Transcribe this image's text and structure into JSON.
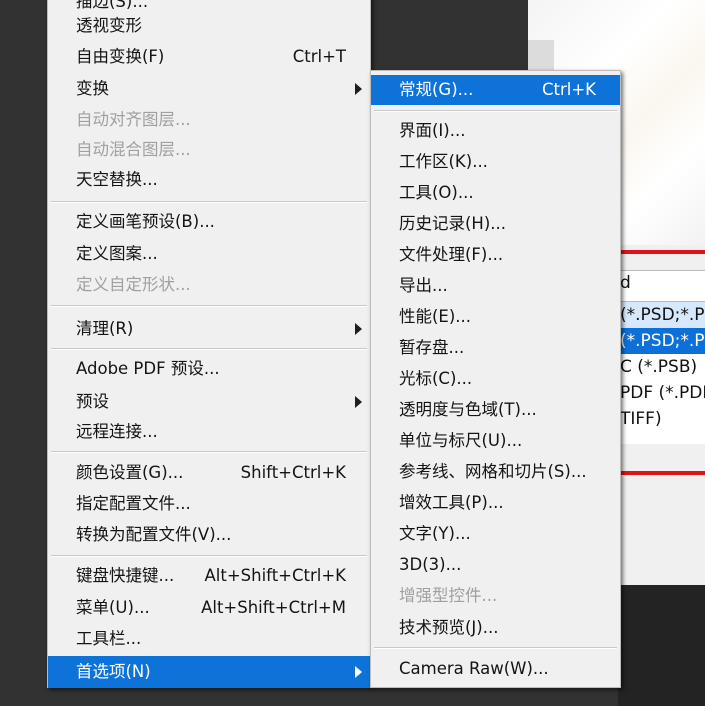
{
  "main_menu": {
    "items": [
      {
        "label": "描边(S)...",
        "shortcut": "",
        "disabled": false
      },
      {
        "label": "透视变形",
        "shortcut": "",
        "disabled": false
      },
      {
        "label": "自由变换(F)",
        "shortcut": "Ctrl+T",
        "disabled": false
      },
      {
        "label": "变换",
        "shortcut": "",
        "disabled": false,
        "submenu": true
      },
      {
        "label": "自动对齐图层...",
        "shortcut": "",
        "disabled": true
      },
      {
        "label": "自动混合图层...",
        "shortcut": "",
        "disabled": true
      },
      {
        "label": "天空替换...",
        "shortcut": "",
        "disabled": false
      },
      {
        "label": "定义画笔预设(B)...",
        "shortcut": "",
        "disabled": false
      },
      {
        "label": "定义图案...",
        "shortcut": "",
        "disabled": false
      },
      {
        "label": "定义自定形状...",
        "shortcut": "",
        "disabled": true
      },
      {
        "label": "清理(R)",
        "shortcut": "",
        "disabled": false,
        "submenu": true
      },
      {
        "label": "Adobe PDF 预设...",
        "shortcut": "",
        "disabled": false
      },
      {
        "label": "预设",
        "shortcut": "",
        "disabled": false,
        "submenu": true
      },
      {
        "label": "远程连接...",
        "shortcut": "",
        "disabled": false
      },
      {
        "label": "颜色设置(G)...",
        "shortcut": "Shift+Ctrl+K",
        "disabled": false
      },
      {
        "label": "指定配置文件...",
        "shortcut": "",
        "disabled": false
      },
      {
        "label": "转换为配置文件(V)...",
        "shortcut": "",
        "disabled": false
      },
      {
        "label": "键盘快捷键...",
        "shortcut": "Alt+Shift+Ctrl+K",
        "disabled": false
      },
      {
        "label": "菜单(U)...",
        "shortcut": "Alt+Shift+Ctrl+M",
        "disabled": false
      },
      {
        "label": "工具栏...",
        "shortcut": "",
        "disabled": false
      },
      {
        "label": "首选项(N)",
        "shortcut": "",
        "disabled": false,
        "submenu": true,
        "highlighted": true
      }
    ]
  },
  "sub_menu": {
    "items": [
      {
        "label": "常规(G)...",
        "shortcut": "Ctrl+K",
        "disabled": false,
        "highlighted": true
      },
      {
        "label": "界面(I)...",
        "shortcut": "",
        "disabled": false
      },
      {
        "label": "工作区(K)...",
        "shortcut": "",
        "disabled": false
      },
      {
        "label": "工具(O)...",
        "shortcut": "",
        "disabled": false
      },
      {
        "label": "历史记录(H)...",
        "shortcut": "",
        "disabled": false
      },
      {
        "label": "文件处理(F)...",
        "shortcut": "",
        "disabled": false
      },
      {
        "label": "导出...",
        "shortcut": "",
        "disabled": false
      },
      {
        "label": "性能(E)...",
        "shortcut": "",
        "disabled": false
      },
      {
        "label": "暂存盘...",
        "shortcut": "",
        "disabled": false
      },
      {
        "label": "光标(C)...",
        "shortcut": "",
        "disabled": false
      },
      {
        "label": "透明度与色域(T)...",
        "shortcut": "",
        "disabled": false
      },
      {
        "label": "单位与标尺(U)...",
        "shortcut": "",
        "disabled": false
      },
      {
        "label": "参考线、网格和切片(S)...",
        "shortcut": "",
        "disabled": false
      },
      {
        "label": "增效工具(P)...",
        "shortcut": "",
        "disabled": false
      },
      {
        "label": "文字(Y)...",
        "shortcut": "",
        "disabled": false
      },
      {
        "label": "3D(3)...",
        "shortcut": "",
        "disabled": false
      },
      {
        "label": "增强型控件...",
        "shortcut": "",
        "disabled": true
      },
      {
        "label": "技术预览(J)...",
        "shortcut": "",
        "disabled": false
      },
      {
        "label": "Camera Raw(W)...",
        "shortcut": "",
        "disabled": false
      }
    ]
  },
  "background_dialog": {
    "field_text": "d",
    "list": [
      {
        "text": "(*.PSD;*.PD"
      },
      {
        "text": "(*.PSD;*.PD"
      },
      {
        "text": "C (*.PSB)"
      },
      {
        "text": "PDF (*.PDF"
      },
      {
        "text": "TIFF)"
      }
    ]
  },
  "colors": {
    "highlight": "#0d73d9",
    "menu_bg": "#f0f0f0",
    "disabled_text": "#a0a0a0",
    "red_guide": "#e0111b"
  }
}
